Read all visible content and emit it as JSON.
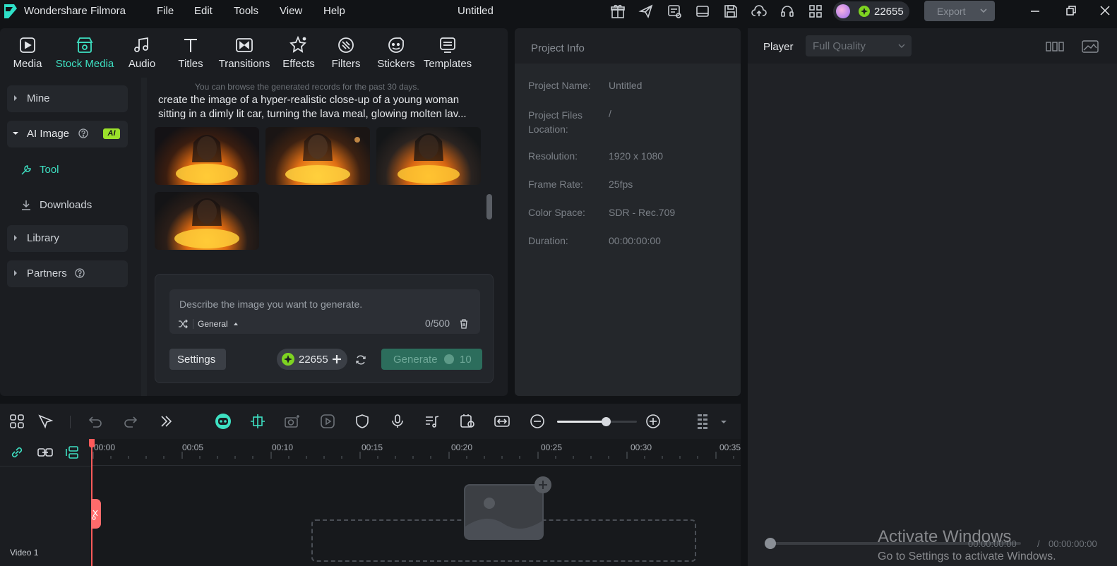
{
  "app": {
    "name": "Wondershare Filmora",
    "project_title": "Untitled"
  },
  "menu": [
    "File",
    "Edit",
    "Tools",
    "View",
    "Help"
  ],
  "topbar": {
    "credits": "22655",
    "export_label": "Export"
  },
  "tabs": [
    "Media",
    "Stock Media",
    "Audio",
    "Titles",
    "Transitions",
    "Effects",
    "Filters",
    "Stickers",
    "Templates"
  ],
  "sidebar": {
    "mine": "Mine",
    "ai_image": "AI Image",
    "ai_badge": "AI",
    "tool": "Tool",
    "downloads": "Downloads",
    "library": "Library",
    "partners": "Partners"
  },
  "ai_panel": {
    "records_note": "You can browse the generated records for the past 30 days.",
    "prompt_line1": "create the image of a hyper-realistic close-up of a young woman",
    "prompt_line2": "sitting in a dimly lit car, turning the lava meal, glowing molten lav...",
    "input_placeholder": "Describe the image you want to generate.",
    "style": "General",
    "char_count": "0/500",
    "settings_label": "Settings",
    "credits": "22655",
    "generate_label": "Generate",
    "generate_cost": "10"
  },
  "project_info": {
    "title": "Project Info",
    "rows": [
      {
        "label": "Project Name:",
        "value": "Untitled"
      },
      {
        "label": "Project Files Location:",
        "value": "/"
      },
      {
        "label": "Resolution:",
        "value": "1920 x 1080"
      },
      {
        "label": "Frame Rate:",
        "value": "25fps"
      },
      {
        "label": "Color Space:",
        "value": "SDR - Rec.709"
      },
      {
        "label": "Duration:",
        "value": "00:00:00:00"
      }
    ]
  },
  "player": {
    "label": "Player",
    "quality": "Full Quality",
    "time_current": "00:00:00:00",
    "time_sep": "/",
    "time_total": "00:00:00:00"
  },
  "timeline": {
    "ticks": [
      "00:00",
      "00:05",
      "00:10",
      "00:15",
      "00:20",
      "00:25",
      "00:30",
      "00:35"
    ],
    "track_label": "Video 1"
  },
  "watermark": {
    "line1": "Activate Windows",
    "line2": "Go to Settings to activate Windows."
  },
  "colors": {
    "accent": "#3ee0c2",
    "credit_green": "#7ed321",
    "generate_bg": "#2c6d5c",
    "playhead": "#ff5a5a"
  }
}
